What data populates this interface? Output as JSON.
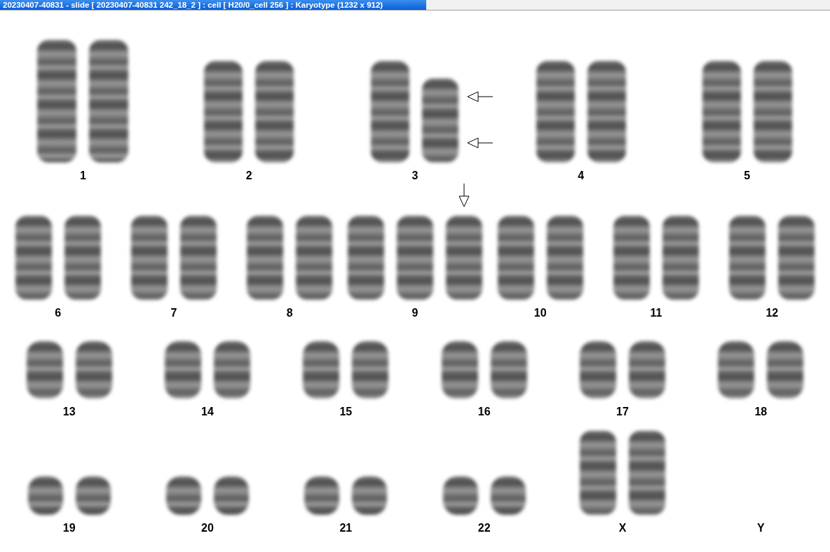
{
  "window": {
    "title": "20230407-40831 - slide [ 20230407-40831 242_18_2 ] : cell [ H20/0_cell 256 ] : Karyotype  (1232 x 912)"
  },
  "rows": [
    {
      "groups": [
        {
          "label": "1",
          "chromosomes": [
            {
              "kind": "large"
            },
            {
              "kind": "large"
            }
          ]
        },
        {
          "label": "2",
          "chromosomes": [
            {
              "kind": "big"
            },
            {
              "kind": "big"
            }
          ]
        },
        {
          "label": "3",
          "chromosomes": [
            {
              "kind": "big"
            },
            {
              "kind": "medium",
              "arrows": [
                {
                  "kind": "left"
                },
                {
                  "kind": "left"
                }
              ]
            }
          ]
        },
        {
          "label": "4",
          "chromosomes": [
            {
              "kind": "big"
            },
            {
              "kind": "big"
            }
          ]
        },
        {
          "label": "5",
          "chromosomes": [
            {
              "kind": "big"
            },
            {
              "kind": "big"
            }
          ]
        }
      ]
    },
    {
      "groups": [
        {
          "label": "6",
          "chromosomes": [
            {
              "kind": "medium"
            },
            {
              "kind": "medium"
            }
          ]
        },
        {
          "label": "7",
          "chromosomes": [
            {
              "kind": "medium"
            },
            {
              "kind": "medium"
            }
          ]
        },
        {
          "label": "8",
          "chromosomes": [
            {
              "kind": "medium"
            },
            {
              "kind": "medium"
            }
          ]
        },
        {
          "label": "9",
          "chromosomes": [
            {
              "kind": "medium"
            },
            {
              "kind": "medium"
            },
            {
              "kind": "medium",
              "arrows": [
                {
                  "kind": "down"
                }
              ]
            }
          ]
        },
        {
          "label": "10",
          "chromosomes": [
            {
              "kind": "medium"
            },
            {
              "kind": "medium"
            }
          ]
        },
        {
          "label": "11",
          "chromosomes": [
            {
              "kind": "medium"
            },
            {
              "kind": "medium"
            }
          ]
        },
        {
          "label": "12",
          "chromosomes": [
            {
              "kind": "medium"
            },
            {
              "kind": "medium"
            }
          ]
        }
      ]
    },
    {
      "groups": [
        {
          "label": "13",
          "chromosomes": [
            {
              "kind": "small"
            },
            {
              "kind": "small"
            }
          ]
        },
        {
          "label": "14",
          "chromosomes": [
            {
              "kind": "small"
            },
            {
              "kind": "small"
            }
          ]
        },
        {
          "label": "15",
          "chromosomes": [
            {
              "kind": "small"
            },
            {
              "kind": "small"
            }
          ]
        },
        {
          "label": "16",
          "chromosomes": [
            {
              "kind": "small"
            },
            {
              "kind": "small"
            }
          ]
        },
        {
          "label": "17",
          "chromosomes": [
            {
              "kind": "small"
            },
            {
              "kind": "small"
            }
          ]
        },
        {
          "label": "18",
          "chromosomes": [
            {
              "kind": "small"
            },
            {
              "kind": "small"
            }
          ]
        }
      ]
    },
    {
      "groups": [
        {
          "label": "19",
          "chromosomes": [
            {
              "kind": "tiny"
            },
            {
              "kind": "tiny"
            }
          ]
        },
        {
          "label": "20",
          "chromosomes": [
            {
              "kind": "tiny"
            },
            {
              "kind": "tiny"
            }
          ]
        },
        {
          "label": "21",
          "chromosomes": [
            {
              "kind": "tiny"
            },
            {
              "kind": "tiny"
            }
          ]
        },
        {
          "label": "22",
          "chromosomes": [
            {
              "kind": "tiny"
            },
            {
              "kind": "tiny"
            }
          ]
        },
        {
          "label": "X",
          "chromosomes": [
            {
              "kind": "medium"
            },
            {
              "kind": "medium"
            }
          ]
        },
        {
          "label": "Y"
        }
      ]
    }
  ]
}
